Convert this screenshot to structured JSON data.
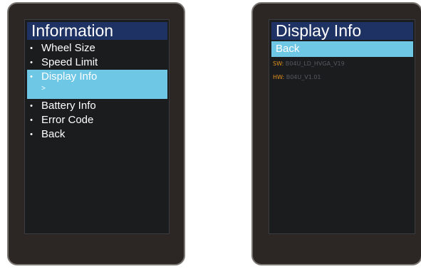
{
  "left_screen": {
    "title": "Information",
    "items": [
      {
        "bullet": "•",
        "label": "Wheel Size",
        "selected": false
      },
      {
        "bullet": "•",
        "label": "Speed Limit",
        "selected": false
      },
      {
        "bullet": "•",
        "label": "Display Info",
        "selected": true,
        "submark": ">"
      },
      {
        "bullet": "•",
        "label": "Battery Info",
        "selected": false
      },
      {
        "bullet": "•",
        "label": "Error Code",
        "selected": false
      },
      {
        "bullet": "•",
        "label": "Back",
        "selected": false
      }
    ]
  },
  "right_screen": {
    "title": "Display Info",
    "back_label": "Back",
    "sw_key": "SW:",
    "sw_value": "B04U_LD_HVGA_V19",
    "hw_key": "HW:",
    "hw_value": "B04U_V1.01"
  },
  "colors": {
    "title_bar": "#1e3263",
    "selection": "#6ec7e5",
    "screen_bg": "#1b1c1e",
    "bezel": "#2c2724",
    "info_key": "#e3911f",
    "info_value": "#55595f"
  }
}
